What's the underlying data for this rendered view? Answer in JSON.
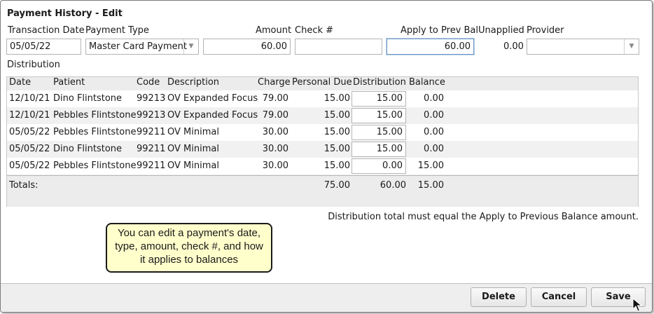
{
  "window": {
    "title": "Payment History - Edit"
  },
  "form": {
    "transaction_date_label": "Transaction Date",
    "transaction_date": "05/05/22",
    "payment_type_label": "Payment Type",
    "payment_type": "Master Card Payment",
    "amount_label": "Amount",
    "amount": "60.00",
    "check_label": "Check #",
    "check": "",
    "apply_label": "Apply to Prev Bal",
    "apply": "60.00",
    "unapplied_label": "Unapplied",
    "unapplied": "0.00",
    "provider_label": "Provider",
    "provider": ""
  },
  "distribution": {
    "section_label": "Distribution",
    "columns": [
      "Date",
      "Patient",
      "Code",
      "Description",
      "Charge",
      "Personal Due",
      "Distribution",
      "Balance"
    ],
    "rows": [
      {
        "date": "12/10/21",
        "patient": "Dino Flintstone",
        "code": "99213",
        "description": "OV Expanded Focus",
        "charge": "79.00",
        "personal_due": "15.00",
        "distribution": "15.00",
        "balance": "0.00"
      },
      {
        "date": "12/10/21",
        "patient": "Pebbles Flintstone",
        "code": "99213",
        "description": "OV Expanded Focus",
        "charge": "79.00",
        "personal_due": "15.00",
        "distribution": "15.00",
        "balance": "0.00"
      },
      {
        "date": "05/05/22",
        "patient": "Pebbles Flintstone",
        "code": "99211",
        "description": "OV Minimal",
        "charge": "30.00",
        "personal_due": "15.00",
        "distribution": "15.00",
        "balance": "0.00"
      },
      {
        "date": "05/05/22",
        "patient": "Dino Flintstone",
        "code": "99211",
        "description": "OV Minimal",
        "charge": "30.00",
        "personal_due": "15.00",
        "distribution": "15.00",
        "balance": "0.00"
      },
      {
        "date": "05/05/22",
        "patient": "Pebbles Flintstone",
        "code": "99211",
        "description": "OV Minimal",
        "charge": "30.00",
        "personal_due": "15.00",
        "distribution": "0.00",
        "balance": "15.00"
      }
    ],
    "totals": {
      "label": "Totals:",
      "personal_due": "75.00",
      "distribution": "60.00",
      "balance": "15.00"
    },
    "note": "Distribution total must equal the Apply to Previous Balance amount."
  },
  "callout": {
    "text": "You can edit a payment's date, type, amount, check #, and how it applies to balances"
  },
  "buttons": {
    "delete": "Delete",
    "cancel": "Cancel",
    "save": "Save"
  },
  "icons": {
    "dropdown": "chevron-down-icon",
    "cursor": "mouse-pointer-icon"
  }
}
